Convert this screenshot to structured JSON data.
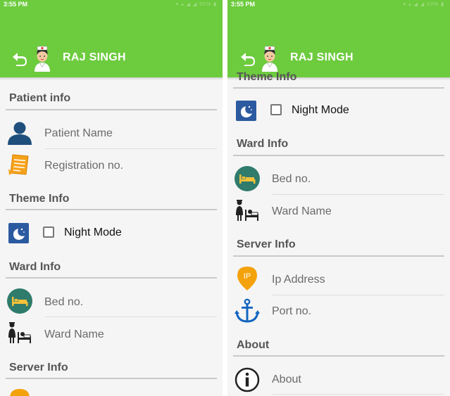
{
  "status_bar": {
    "time": "3:55 PM",
    "icons_text": "▾ ▴ ◢ ◢ 50% ▮"
  },
  "app_bar": {
    "user_name": "RAJ SINGH"
  },
  "sections": {
    "patient_info": {
      "title": "Patient info",
      "patient_name": "Patient Name",
      "registration_no": "Registration no."
    },
    "theme_info": {
      "title": "Theme Info",
      "night_mode": "Night Mode",
      "night_mode_checked": false
    },
    "ward_info": {
      "title": "Ward Info",
      "bed_no": "Bed no.",
      "ward_name": "Ward Name"
    },
    "server_info": {
      "title": "Server Info",
      "ip_address": "Ip Address",
      "ip_icon_text": "IP",
      "port_no": "Port no."
    },
    "about": {
      "title": "About",
      "about_item": "About"
    }
  },
  "colors": {
    "app_bar": "#6dcb3e",
    "section_header": "#555555",
    "item_text": "#6a6a6a",
    "patient_icon": "#1f4f7c",
    "night_icon": "#2c5aa0",
    "bed_icon": "#2f7b6c",
    "ip_icon": "#f4a20c",
    "anchor_icon": "#1565c0"
  },
  "icons": {
    "back": "back-arrow-icon",
    "avatar": "nurse-avatar-icon",
    "patient": "person-icon",
    "registration": "document-icon",
    "night_mode": "night-mode-icon",
    "bed": "bed-icon",
    "ward": "ward-icon",
    "ip": "ip-address-icon",
    "port": "anchor-icon",
    "about": "info-icon"
  }
}
